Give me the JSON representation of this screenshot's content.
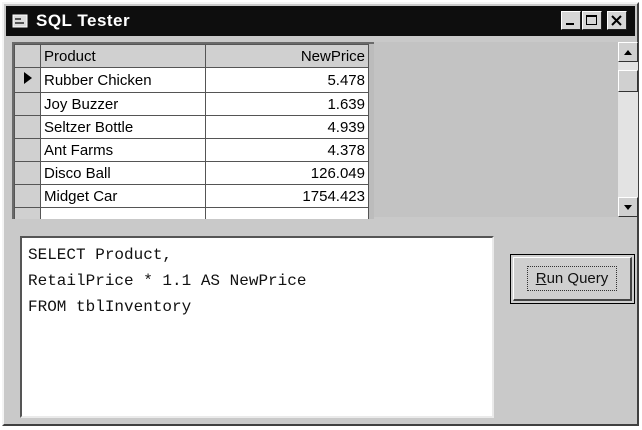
{
  "window": {
    "title": "SQL Tester"
  },
  "grid": {
    "columns": [
      "Product",
      "NewPrice"
    ],
    "rows": [
      {
        "product": "Rubber Chicken",
        "price": "5.478",
        "current": true
      },
      {
        "product": "Joy Buzzer",
        "price": "1.639",
        "current": false
      },
      {
        "product": "Seltzer Bottle",
        "price": "4.939",
        "current": false
      },
      {
        "product": "Ant Farms",
        "price": "4.378",
        "current": false
      },
      {
        "product": "Disco Ball",
        "price": "126.049",
        "current": false
      },
      {
        "product": "Midget Car",
        "price": "1754.423",
        "current": false
      }
    ]
  },
  "query": {
    "lines": [
      "SELECT Product,",
      "RetailPrice * 1.1 AS NewPrice",
      "FROM tblInventory"
    ]
  },
  "run_button": {
    "mnemonic": "R",
    "rest": "un Query"
  },
  "icons": {
    "title": "window-icon",
    "minimize": "minimize-icon",
    "maximize": "maximize-icon",
    "close": "close-icon",
    "row_pointer": "row-pointer-icon",
    "scroll_up": "scroll-up-icon",
    "scroll_down": "scroll-down-icon"
  }
}
